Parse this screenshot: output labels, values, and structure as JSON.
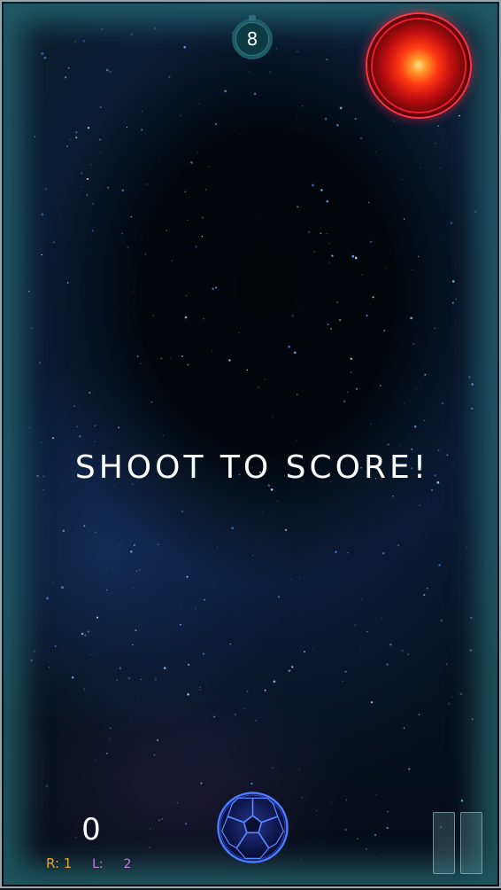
{
  "hud": {
    "timer_value": "8",
    "message": "SHOOT TO SCORE!",
    "score": "0",
    "r_label": "R:",
    "r_value": "1",
    "l_label": "L:",
    "l_value": "2"
  },
  "icons": {
    "timer": "stopwatch-icon",
    "target": "glowing-red-goal-target",
    "ball": "soccer-ball-icon",
    "pause": "pause-icon"
  },
  "colors": {
    "frame_glow": "#2f7e88",
    "timer_bg": "#1f5a66",
    "target_ring": "#e81c30",
    "ball_line": "#3a6aff",
    "r_color": "#e6a12a",
    "l_color": "#c47ad8"
  }
}
